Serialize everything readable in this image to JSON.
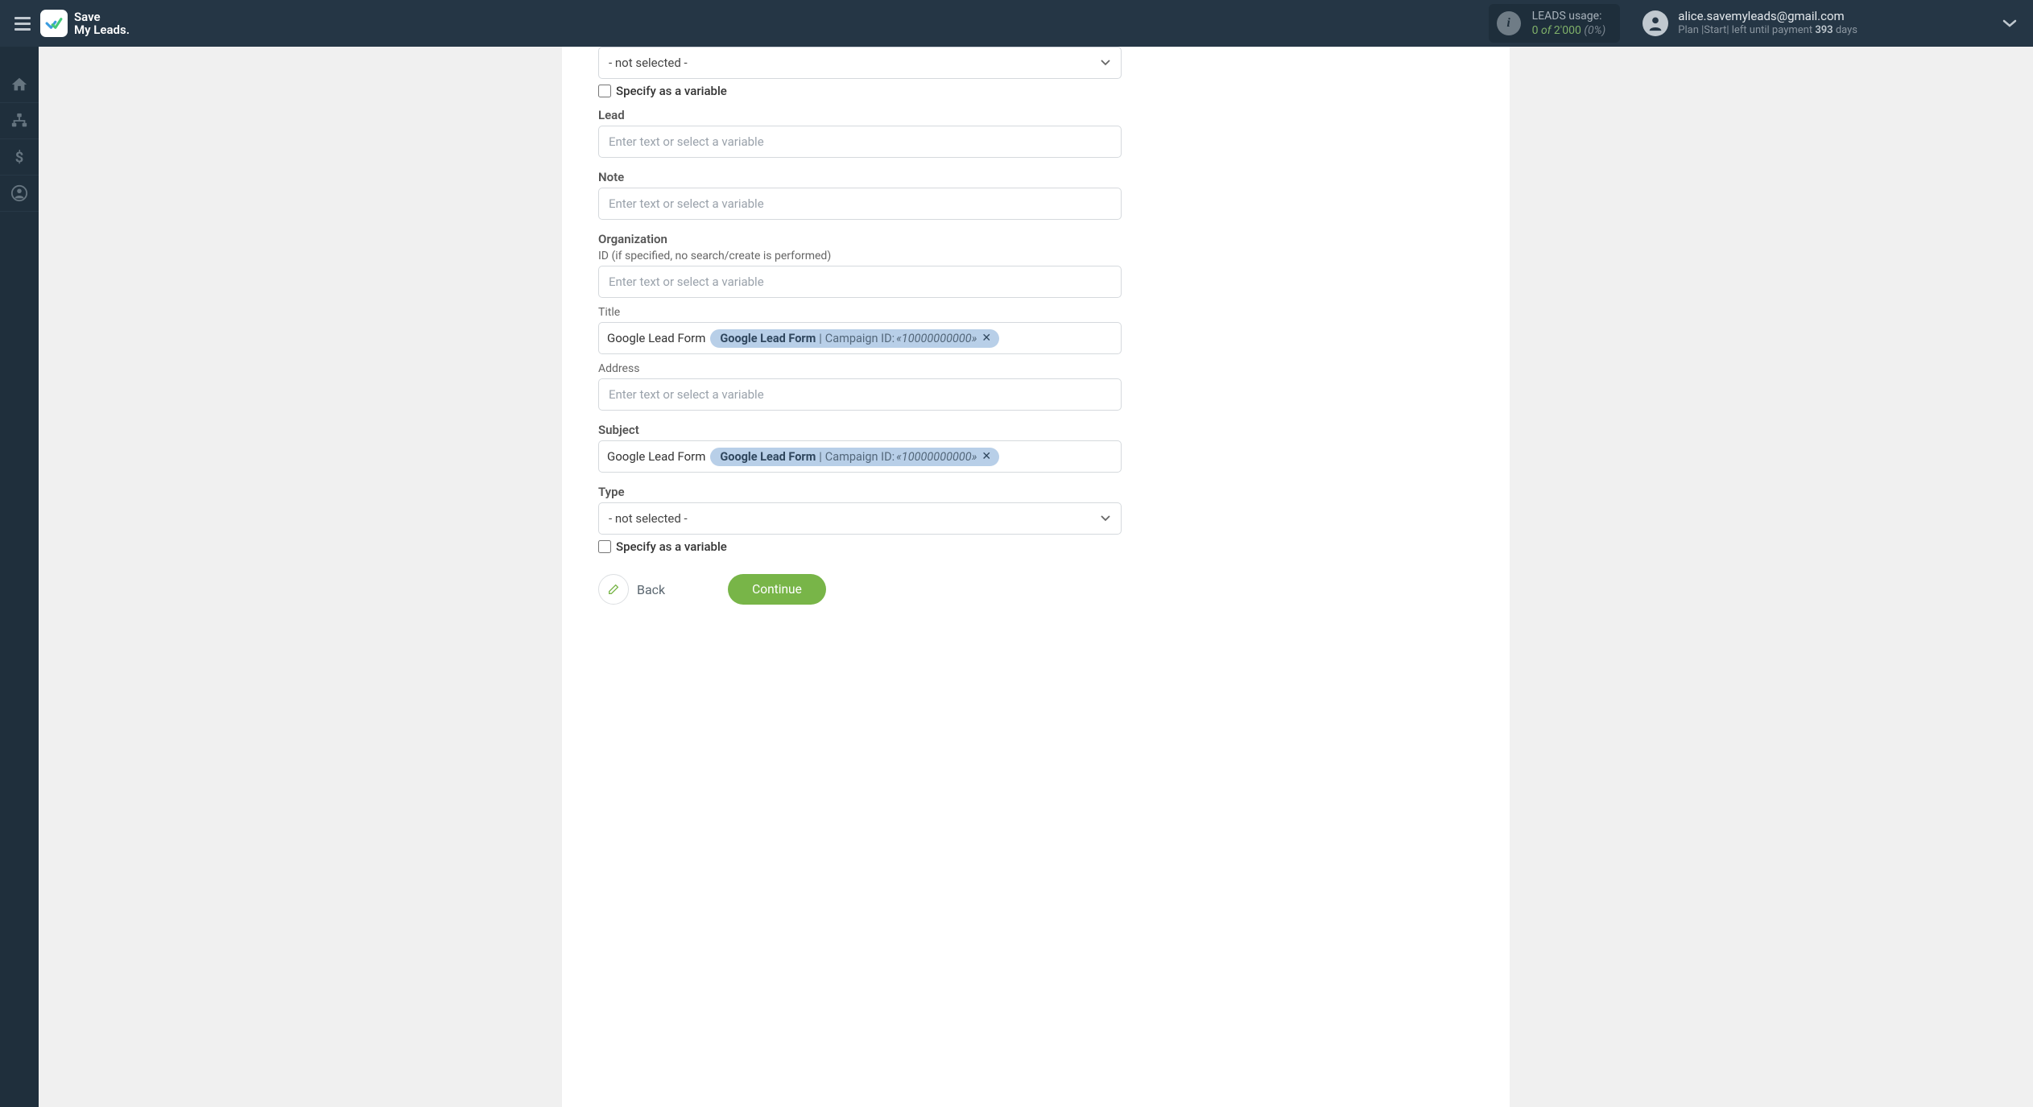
{
  "header": {
    "logo_line1": "Save",
    "logo_line2": "My Leads.",
    "usage": {
      "title": "LEADS usage:",
      "current": "0",
      "of_word": "of",
      "max": "2'000",
      "percent": "(0%)"
    },
    "account": {
      "email": "alice.savemyleads@gmail.com",
      "plan_prefix": "Plan |Start| left until payment",
      "days": "393",
      "days_suffix": "days"
    }
  },
  "form": {
    "select_top_value": "- not selected -",
    "specify_variable_label": "Specify as a variable",
    "lead": {
      "label": "Lead",
      "placeholder": "Enter text or select a variable"
    },
    "note": {
      "label": "Note",
      "placeholder": "Enter text or select a variable"
    },
    "organization": {
      "label": "Organization",
      "id_sublabel": "ID (if specified, no search/create is performed)",
      "id_placeholder": "Enter text or select a variable",
      "title_label": "Title",
      "title_prefix": "Google Lead Form",
      "title_tag_source": "Google Lead Form",
      "title_tag_label": "Campaign ID:",
      "title_tag_value": "«10000000000»",
      "address_label": "Address",
      "address_placeholder": "Enter text or select a variable"
    },
    "subject": {
      "label": "Subject",
      "prefix": "Google Lead Form",
      "tag_source": "Google Lead Form",
      "tag_label": "Campaign ID:",
      "tag_value": "«10000000000»"
    },
    "type": {
      "label": "Type",
      "value": "- not selected -"
    },
    "specify_variable_label2": "Specify as a variable",
    "actions": {
      "back": "Back",
      "continue": "Continue"
    }
  }
}
